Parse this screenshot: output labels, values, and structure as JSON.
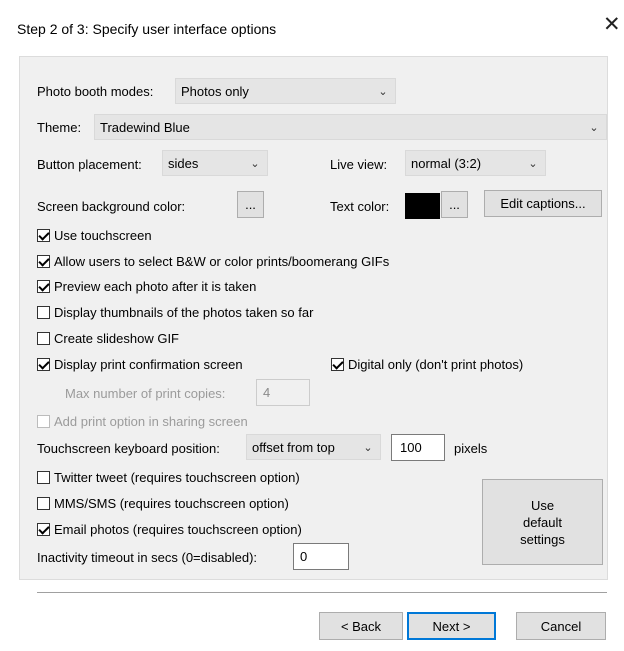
{
  "window": {
    "title": "Step 2 of 3: Specify user interface options",
    "close_glyph": "✕"
  },
  "modes": {
    "label": "Photo booth modes:",
    "value": "Photos only"
  },
  "theme": {
    "label": "Theme:",
    "value": "Tradewind Blue"
  },
  "button_placement": {
    "label": "Button placement:",
    "value": "sides"
  },
  "live_view": {
    "label": "Live view:",
    "value": "normal (3:2)"
  },
  "screen_bg": {
    "label": "Screen background color:",
    "picker": "...",
    "color": "#f0f0f0"
  },
  "text_color": {
    "label": "Text color:",
    "picker": "...",
    "color": "#000000"
  },
  "edit_captions": "Edit captions...",
  "checkboxes": {
    "use_touchscreen": {
      "label": "Use touchscreen",
      "checked": true
    },
    "allow_select": {
      "label": "Allow users to select B&W or color prints/boomerang GIFs",
      "checked": true
    },
    "preview": {
      "label": "Preview each photo after it is taken",
      "checked": true
    },
    "thumbnails": {
      "label": "Display thumbnails of the photos taken so far",
      "checked": false
    },
    "slideshow": {
      "label": "Create slideshow GIF",
      "checked": false
    },
    "print_confirm": {
      "label": "Display print confirmation screen",
      "checked": true
    },
    "digital_only": {
      "label": "Digital only (don't print photos)",
      "checked": true
    },
    "add_print": {
      "label": "Add print option in sharing screen",
      "checked": false,
      "disabled": true
    },
    "twitter": {
      "label": "Twitter tweet (requires touchscreen option)",
      "checked": false
    },
    "mms": {
      "label": "MMS/SMS (requires touchscreen option)",
      "checked": false
    },
    "email": {
      "label": "Email photos (requires touchscreen option)",
      "checked": true
    }
  },
  "max_copies": {
    "label": "Max number of print copies:",
    "value": "4"
  },
  "keyboard": {
    "label": "Touchscreen keyboard position:",
    "value": "offset from top",
    "offset": "100",
    "unit": "pixels"
  },
  "inactivity": {
    "label": "Inactivity timeout in secs (0=disabled):",
    "value": "0"
  },
  "default_btn": {
    "line1": "Use",
    "line2": "default",
    "line3": "settings"
  },
  "footer": {
    "back": "< Back",
    "next": "Next >",
    "cancel": "Cancel"
  },
  "icons": {
    "chevron": "chevron-down-icon",
    "close": "close-icon"
  }
}
